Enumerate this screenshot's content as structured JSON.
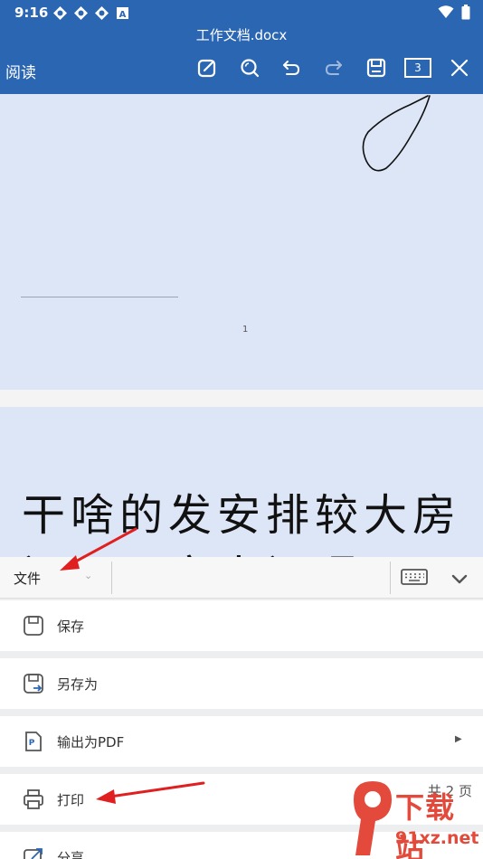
{
  "status_bar": {
    "time": "9:16",
    "left_icons": [
      "app-notification-icon",
      "app-notification-icon",
      "app-notification-icon",
      "a-badge-icon"
    ],
    "right_icons": [
      "wifi-icon",
      "battery-icon"
    ]
  },
  "header": {
    "document_title": "工作文档.docx",
    "mode_label": "阅读",
    "page_count": "3",
    "toolbar_icons": [
      "edit-icon",
      "search-icon",
      "undo-icon",
      "redo-icon",
      "save-icon",
      "page-count-icon",
      "close-icon"
    ]
  },
  "document": {
    "page1_number": "1",
    "page2_line1": "干啥的发安排较大房",
    "page2_line2": "间不而实人问嗯"
  },
  "panel": {
    "file_tab": "文件",
    "items": [
      {
        "label": "保存",
        "icon": "save-icon"
      },
      {
        "label": "另存为",
        "icon": "save-as-icon"
      },
      {
        "label": "输出为PDF",
        "icon": "pdf-icon"
      },
      {
        "label": "打印",
        "icon": "print-icon",
        "extra": "共 2 页"
      },
      {
        "label": "分享",
        "icon": "share-icon"
      }
    ]
  },
  "watermark": {
    "line1": "下载站",
    "line2": "91xz.net"
  },
  "colors": {
    "header_blue": "#2b66b3",
    "page_blue": "#dde6f6",
    "annotation_red": "#e02020"
  }
}
